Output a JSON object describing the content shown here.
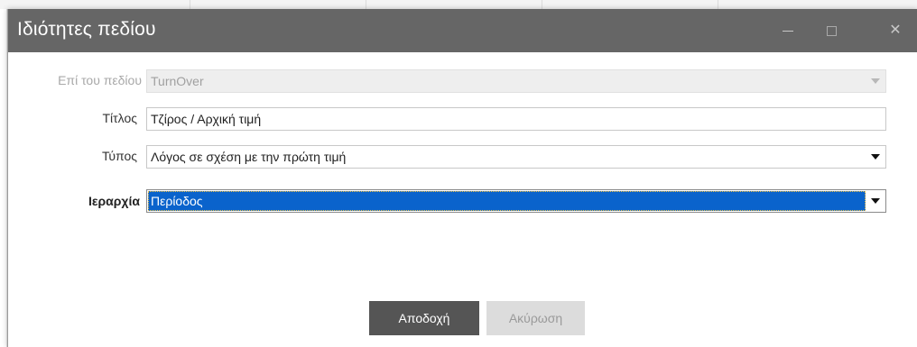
{
  "dialog": {
    "title": "Ιδιότητες πεδίου"
  },
  "form": {
    "field_label": "Επί του πεδίου",
    "field_value": "TurnOver",
    "title_label": "Τίτλος",
    "title_value": "Τζίρος / Αρχική τιμή",
    "type_label": "Τύπος",
    "type_value": "Λόγος σε σχέση με την πρώτη τιμή",
    "hierarchy_label": "Ιεραρχία",
    "hierarchy_value": "Περίοδος"
  },
  "buttons": {
    "ok": "Αποδοχή",
    "cancel": "Ακύρωση"
  },
  "colors": {
    "titlebar": "#666666",
    "selection": "#0a63cc",
    "ok_button": "#555555",
    "cancel_button": "#dcdcdc"
  },
  "icons": {
    "minimize": "minimize-icon",
    "maximize": "maximize-icon",
    "close": "close-icon",
    "dropdown": "chevron-down-icon"
  }
}
